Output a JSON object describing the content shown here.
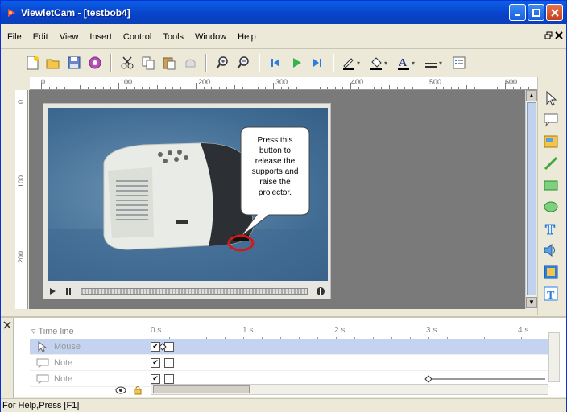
{
  "window": {
    "title": "ViewletCam - [testbob4]"
  },
  "menu": {
    "items": [
      {
        "label": "File"
      },
      {
        "label": "Edit"
      },
      {
        "label": "View"
      },
      {
        "label": "Insert"
      },
      {
        "label": "Control"
      },
      {
        "label": "Tools"
      },
      {
        "label": "Window"
      },
      {
        "label": "Help"
      }
    ],
    "mdi": [
      "_",
      "&#9634;",
      "x"
    ]
  },
  "rulers": {
    "h": [
      "0",
      "100",
      "200",
      "300",
      "400",
      "500",
      "600"
    ],
    "v": [
      "0",
      "100",
      "200"
    ]
  },
  "callout": {
    "lines": [
      "Press this",
      "button to",
      "release the",
      "supports and",
      "raise the",
      "projector."
    ]
  },
  "timeline": {
    "header": "Time line",
    "ticks": [
      "0 s",
      "1 s",
      "2 s",
      "3 s",
      "4 s"
    ],
    "rows": [
      {
        "label": "Mouse",
        "checked": true
      },
      {
        "label": "Note",
        "checked": true
      },
      {
        "label": "Note",
        "checked": true
      }
    ]
  },
  "status": {
    "text": "For Help,Press [F1]"
  },
  "colors": {
    "titlebar": "#0a5fe6",
    "canvas": "#7a7a7a",
    "highlight": "#c3d3f0",
    "circle": "#d11a1a"
  }
}
